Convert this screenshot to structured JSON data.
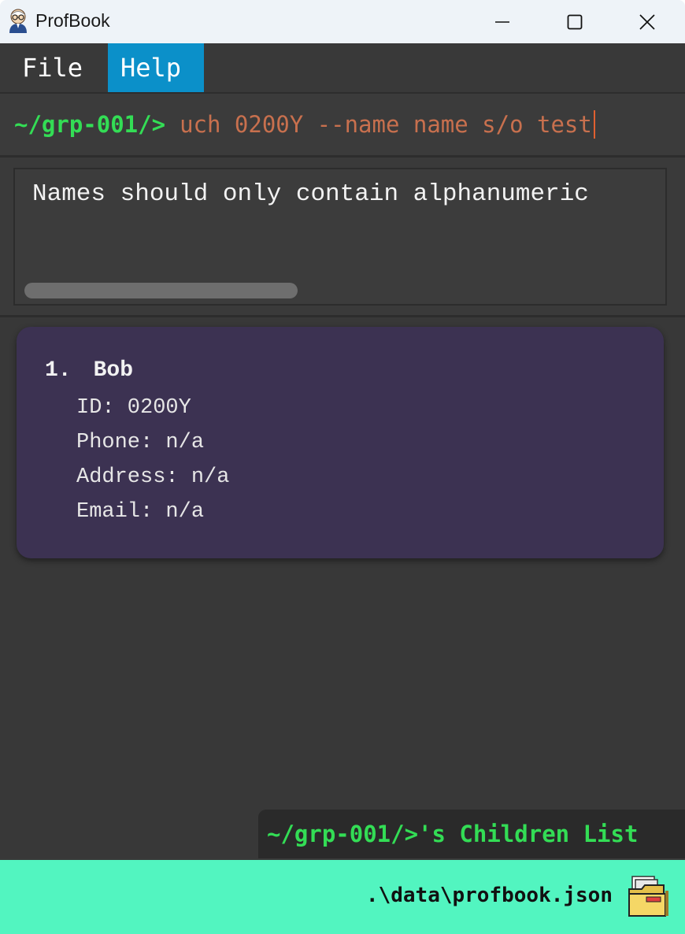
{
  "window": {
    "title": "ProfBook",
    "app_icon": "professor-avatar-icon",
    "controls": [
      "minimize-icon",
      "maximize-icon",
      "close-icon"
    ]
  },
  "menu": {
    "file_label": "File",
    "help_label": "Help"
  },
  "command": {
    "prompt": "~/grp-001/>",
    "value": "uch 0200Y --name name s/o test"
  },
  "result": {
    "message": "Names should only contain alphanumeric"
  },
  "students": [
    {
      "index": "1.",
      "name": "Bob",
      "id_line": "ID: 0200Y",
      "phone_line": "Phone: n/a",
      "address_line": "Address: n/a",
      "email_line": "Email: n/a"
    }
  ],
  "list_label": "~/grp-001/>'s Children List",
  "status": {
    "file_path": ".\\data\\profbook.json",
    "icon": "folder-icon"
  },
  "colors": {
    "background": "#383838",
    "menu_active": "#0b90c9",
    "prompt_green": "#33dd55",
    "command_text": "#c8704e",
    "card": "#3c3252",
    "status_bar": "#52f5c0"
  }
}
